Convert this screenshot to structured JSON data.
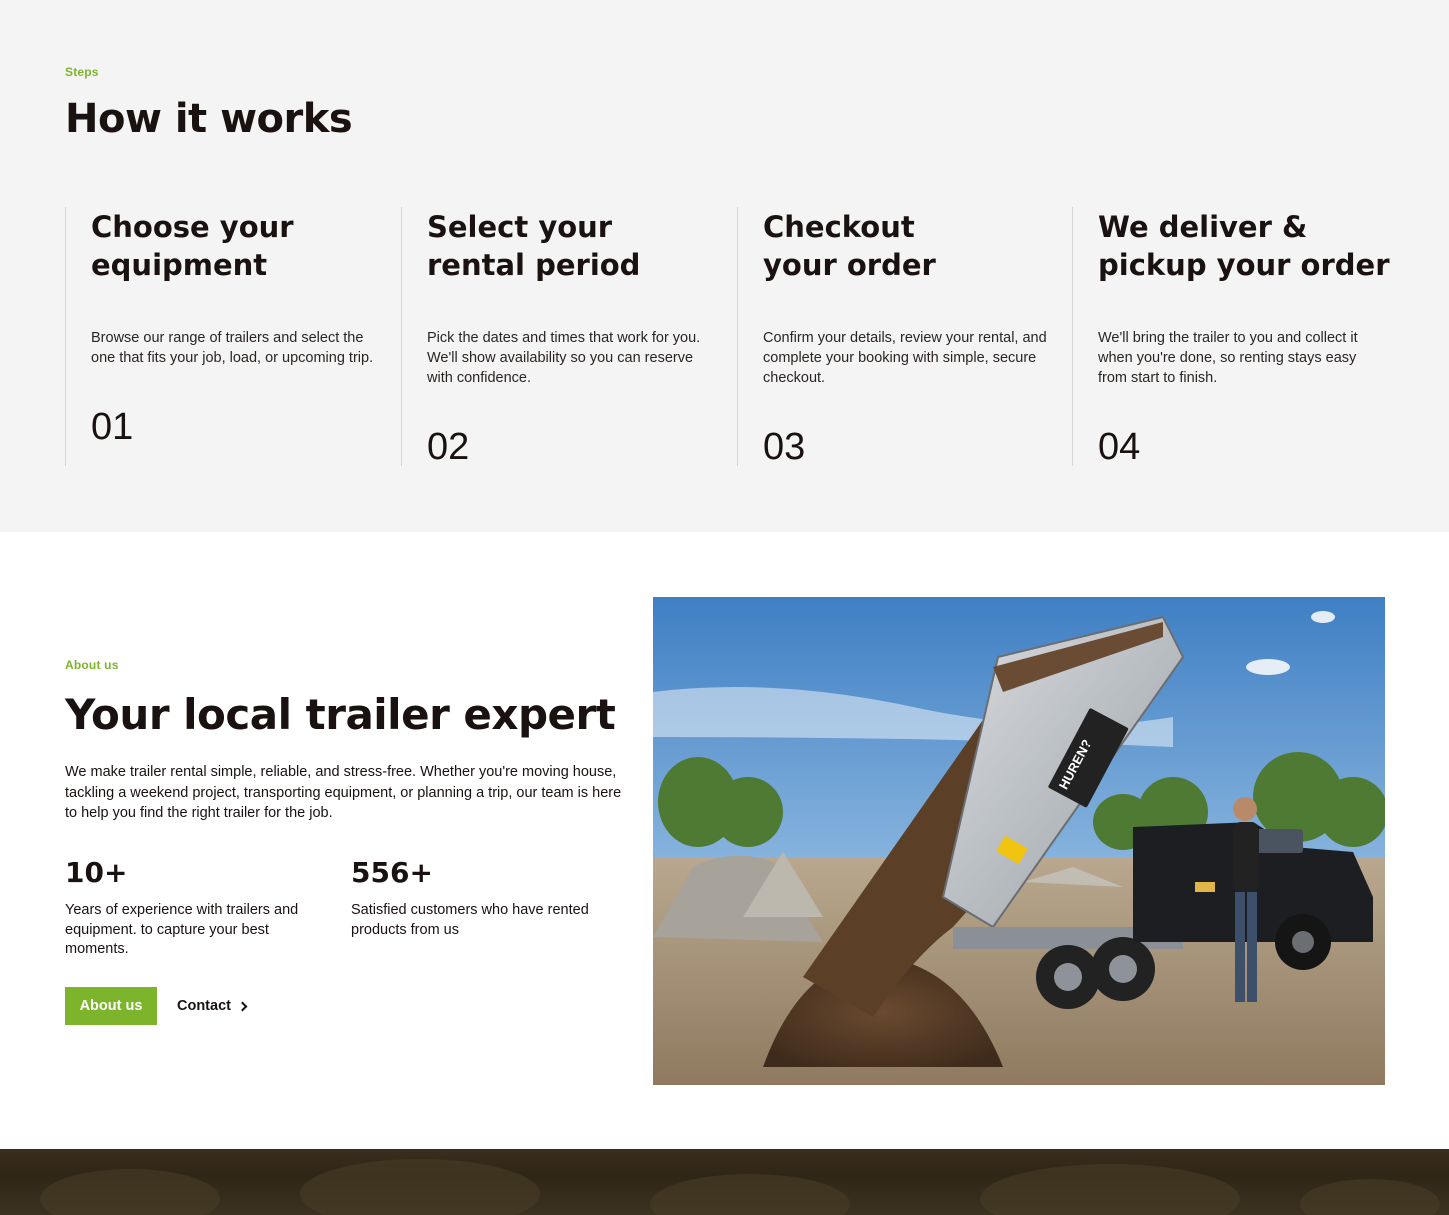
{
  "colors": {
    "accent": "#7cb52b",
    "text": "#1a1210",
    "steps_bg": "#f4f4f4"
  },
  "steps": {
    "eyebrow": "Steps",
    "title": "How it works",
    "items": [
      {
        "title_line1": "Choose your",
        "title_line2": "equipment",
        "description": "Browse our range of trailers and select the one that fits your job, load, or upcoming trip.",
        "number": "01"
      },
      {
        "title_line1": "Select your",
        "title_line2": "rental period",
        "description": "Pick the dates and times that work for you. We'll show availability so you can reserve with confidence.",
        "number": "02"
      },
      {
        "title_line1": "Checkout",
        "title_line2": "your order",
        "description": "Confirm your details, review your rental, and complete your booking with simple, secure checkout.",
        "number": "03"
      },
      {
        "title_line1": "We deliver &",
        "title_line2": "pickup your order",
        "description": "We'll bring the trailer to you and collect it when you're done, so renting stays easy from start to finish.",
        "number": "04"
      }
    ]
  },
  "about": {
    "eyebrow": "About us",
    "title": "Your local trailer expert",
    "text": "We make trailer rental simple, reliable, and stress-free. Whether you're moving house, tackling a weekend project, transporting equipment, or planning a trip, our team is here to help you find the right trailer for the job.",
    "stats": [
      {
        "value": "10+",
        "label": "Years of experience with trailers and equipment. to capture your best moments."
      },
      {
        "value": "556+",
        "label": "Satisfied customers who have rented products from us"
      }
    ],
    "primary_button": "About us",
    "secondary_button": "Contact",
    "image_alt": "Tipping trailer unloading soil next to a pickup truck",
    "trailer_sign": "HUREN?"
  }
}
